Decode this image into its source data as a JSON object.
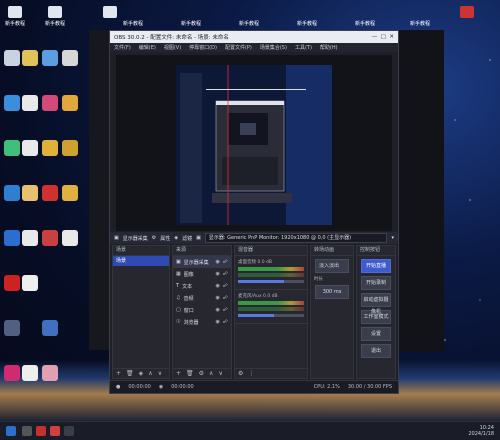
{
  "window": {
    "title": "OBS 30.0.2 - 配置文件: 未命名 - 场景: 未命名",
    "menu": [
      "文件(F)",
      "编辑(E)",
      "视图(V)",
      "停靠窗口(D)",
      "配置文件(P)",
      "场景集合(S)",
      "工具(T)",
      "帮助(H)"
    ]
  },
  "top_icons": [
    "新手教程",
    "新手教程",
    "新手教程",
    "新手教程",
    "新手教程",
    "新手教程",
    "新手教程",
    "新手教程"
  ],
  "context_bar": {
    "source_label": "显示器采集",
    "properties_label": "属性",
    "filters_label": "滤镜",
    "display_value": "显示器: Generic PnP Monitor: 1920x1080 @ 0,0 (主显示器)"
  },
  "scenes": {
    "header": "场景",
    "items": [
      "场景"
    ]
  },
  "sources": {
    "header": "来源",
    "items": [
      "显示器采集",
      "图像",
      "文本",
      "音频",
      "窗口",
      "浏览器"
    ]
  },
  "mixer": {
    "header": "混音器",
    "channels": [
      {
        "name": "桌面音频",
        "db": "0.0 dB",
        "level": 0.7
      },
      {
        "name": "麦克风/Aux",
        "db": "0.0 dB",
        "level": 0.55
      }
    ]
  },
  "transitions": {
    "header": "转场动画",
    "type": "淡入淡出",
    "duration_label": "时长",
    "duration": "300 ms"
  },
  "controls": {
    "header": "控制按钮",
    "buttons": [
      "开始直播",
      "开始录制",
      "启动虚拟摄像机",
      "工作室模式",
      "设置",
      "退出"
    ]
  },
  "status": {
    "live": "00:00:00",
    "rec": "00:00:00",
    "cpu": "CPU: 2.1%",
    "fps": "30.00 / 30.00 FPS"
  },
  "taskbar": {
    "time": "10:24",
    "date": "2024/1/18"
  },
  "colors": {
    "accent": "#3c5bd0",
    "panel": "#26272f",
    "window": "#1e1f27"
  }
}
